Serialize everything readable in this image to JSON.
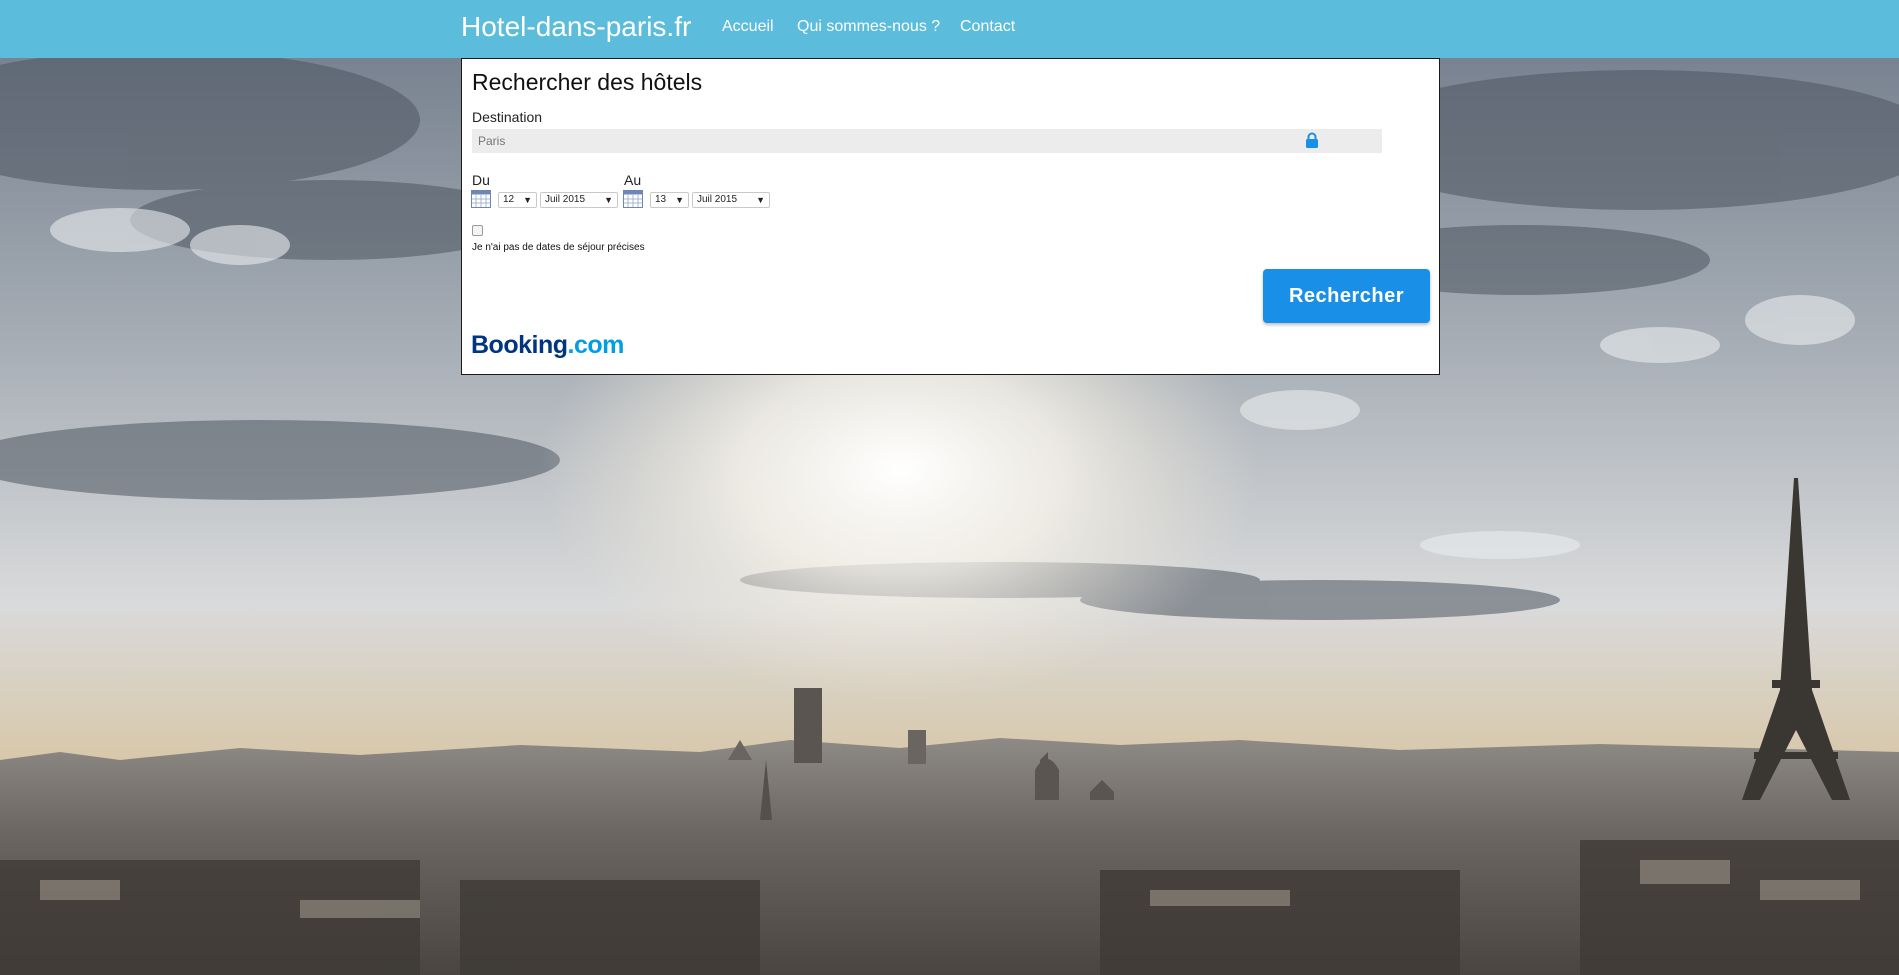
{
  "header": {
    "brand": "Hotel-dans-paris.fr",
    "nav": [
      {
        "label": "Accueil"
      },
      {
        "label": "Qui sommes-nous ?"
      },
      {
        "label": "Contact"
      }
    ]
  },
  "search": {
    "title": "Rechercher des hôtels",
    "destination_label": "Destination",
    "destination_placeholder": "Paris",
    "from_label": "Du",
    "from_day": "12",
    "from_month": "Juil 2015",
    "to_label": "Au",
    "to_day": "13",
    "to_month": "Juil 2015",
    "no_dates_checked": false,
    "no_dates_label": "Je n'ai pas de dates de séjour précises",
    "button_label": "Rechercher",
    "logo_main": "Booking",
    "logo_suffix": ".com"
  },
  "colors": {
    "navbar": "#5bbcdc",
    "button": "#1a8fe8",
    "booking_blue": "#003580",
    "booking_light": "#009fe3"
  },
  "icons": [
    "lock-icon",
    "calendar-icon",
    "dropdown-caret-icon"
  ]
}
